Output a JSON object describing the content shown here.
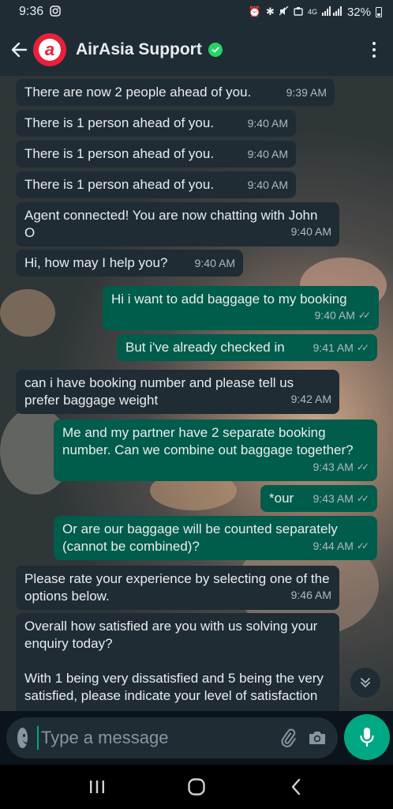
{
  "status_bar": {
    "time": "9:36",
    "network": "4G",
    "battery": "32%"
  },
  "header": {
    "title": "AirAsia Support",
    "avatar_letter": "a"
  },
  "messages": [
    {
      "dir": "in",
      "text": "There are now 2 people ahead of you.",
      "time": "9:39 AM"
    },
    {
      "dir": "in",
      "text": "There is 1 person ahead of you.",
      "time": "9:40 AM"
    },
    {
      "dir": "in",
      "text": "There is 1 person ahead of you.",
      "time": "9:40 AM"
    },
    {
      "dir": "in",
      "text": "There is 1 person ahead of you.",
      "time": "9:40 AM"
    },
    {
      "dir": "in",
      "text": "Agent connected! You are now chatting with John O",
      "time": "9:40 AM"
    },
    {
      "dir": "in",
      "text": "Hi, how may I help you?",
      "time": "9:40 AM"
    },
    {
      "dir": "out",
      "text": "Hi i want to add baggage to my booking",
      "time": "9:40 AM"
    },
    {
      "dir": "out",
      "text": "But i've already checked in",
      "time": "9:41 AM"
    },
    {
      "dir": "in",
      "text": "can i have booking number and please tell us prefer baggage weight",
      "time": "9:42 AM"
    },
    {
      "dir": "out",
      "text": "Me and my partner have 2 separate booking number. Can we combine out baggage together?",
      "time": "9:43 AM"
    },
    {
      "dir": "out",
      "text": "*our",
      "time": "9:43 AM"
    },
    {
      "dir": "out",
      "text": "Or are our baggage will be counted separately (cannot be combined)?",
      "time": "9:44 AM"
    },
    {
      "dir": "in",
      "text": "Please rate your experience by selecting one of the options below.",
      "time": "9:46 AM"
    },
    {
      "dir": "in",
      "text": "Overall how satisfied are you with us solving your enquiry today?",
      "text2": "With 1 being very dissatisfied and 5 being the very satisfied, please indicate your level of satisfaction",
      "time": ""
    }
  ],
  "composer": {
    "placeholder": "Type a message"
  },
  "colors": {
    "incoming_bubble": "#1f2c34",
    "outgoing_bubble": "#005c4b",
    "accent": "#00a884",
    "brand": "#e8203a"
  }
}
